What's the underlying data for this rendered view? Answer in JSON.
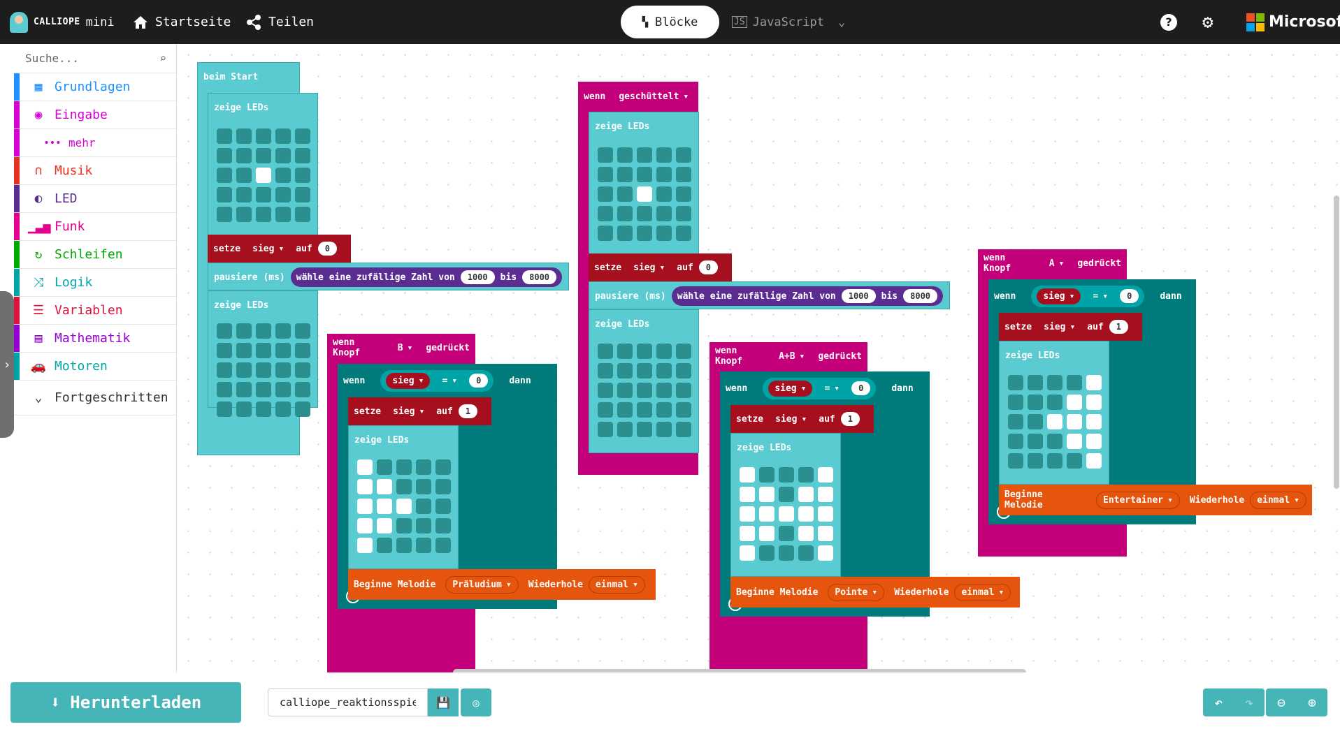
{
  "topbar": {
    "brand": "CALLIOPE",
    "brand_suffix": "mini",
    "home_label": "Startseite",
    "share_label": "Teilen",
    "blocks_label": "Blöcke",
    "javascript_label": "JavaScript",
    "microsoft_label": "Microsoft"
  },
  "sidebar": {
    "search_placeholder": "Suche...",
    "categories": [
      {
        "label": "Grundlagen",
        "color": "#1e90ff"
      },
      {
        "label": "Eingabe",
        "color": "#d400d4"
      },
      {
        "label": "mehr",
        "color": "#d400d4"
      },
      {
        "label": "Musik",
        "color": "#e63022"
      },
      {
        "label": "LED",
        "color": "#5c2d91"
      },
      {
        "label": "Funk",
        "color": "#e3008c"
      },
      {
        "label": "Schleifen",
        "color": "#00aa00"
      },
      {
        "label": "Logik",
        "color": "#00a4a6"
      },
      {
        "label": "Variablen",
        "color": "#dc143c"
      },
      {
        "label": "Mathematik",
        "color": "#9400d3"
      },
      {
        "label": "Motoren",
        "color": "#00a4a6"
      }
    ],
    "advanced_label": "Fortgeschritten"
  },
  "blocks": {
    "start": {
      "hat": "beim Start",
      "show_leds": "zeige LEDs",
      "set": "setze",
      "var": "sieg",
      "to": "auf",
      "val0": "0",
      "pause": "pausiere (ms)",
      "random": "wähle eine zufällige Zahl von",
      "from": "1000",
      "between": "bis",
      "to_val": "8000",
      "show_leds2": "zeige LEDs"
    },
    "shake": {
      "when": "wenn",
      "event": "geschüttelt",
      "show_leds": "zeige LEDs",
      "set": "setze",
      "var": "sieg",
      "to": "auf",
      "val0": "0",
      "pause": "pausiere (ms)",
      "random": "wähle eine zufällige Zahl von",
      "from": "1000",
      "between": "bis",
      "to_val": "8000",
      "show_leds2": "zeige LEDs"
    },
    "btnB": {
      "hat_pre": "wenn Knopf",
      "button": "B",
      "hat_post": "gedrückt",
      "if": "wenn",
      "var": "sieg",
      "op": "=",
      "cmp": "0",
      "then": "dann",
      "set": "setze",
      "to": "auf",
      "val": "1",
      "show_leds": "zeige LEDs",
      "melody": "Beginne Melodie",
      "tune": "Präludium",
      "repeat": "Wiederhole",
      "times": "einmal"
    },
    "btnAB": {
      "hat_pre": "wenn Knopf",
      "button": "A+B",
      "hat_post": "gedrückt",
      "if": "wenn",
      "var": "sieg",
      "op": "=",
      "cmp": "0",
      "then": "dann",
      "set": "setze",
      "to": "auf",
      "val": "1",
      "show_leds": "zeige LEDs",
      "melody": "Beginne Melodie",
      "tune": "Pointe",
      "repeat": "Wiederhole",
      "times": "einmal"
    },
    "btnA": {
      "hat_pre": "wenn Knopf",
      "button": "A",
      "hat_post": "gedrückt",
      "if": "wenn",
      "var": "sieg",
      "op": "=",
      "cmp": "0",
      "then": "dann",
      "set": "setze",
      "to": "auf",
      "val": "1",
      "show_leds": "zeige LEDs",
      "melody": "Beginne Melodie",
      "tune": "Entertainer",
      "repeat": "Wiederhole",
      "times": "einmal"
    }
  },
  "led_patterns": {
    "start_a": [
      0,
      0,
      0,
      0,
      0,
      0,
      0,
      0,
      0,
      0,
      0,
      0,
      1,
      0,
      0,
      0,
      0,
      0,
      0,
      0,
      0,
      0,
      0,
      0,
      0
    ],
    "start_b": [
      0,
      0,
      0,
      0,
      0,
      0,
      0,
      0,
      0,
      0,
      0,
      0,
      0,
      0,
      0,
      0,
      0,
      0,
      0,
      0,
      0,
      0,
      0,
      0,
      0
    ],
    "shake_a": [
      0,
      0,
      0,
      0,
      0,
      0,
      0,
      0,
      0,
      0,
      0,
      0,
      1,
      0,
      0,
      0,
      0,
      0,
      0,
      0,
      0,
      0,
      0,
      0,
      0
    ],
    "shake_b": [
      0,
      0,
      0,
      0,
      0,
      0,
      0,
      0,
      0,
      0,
      0,
      0,
      0,
      0,
      0,
      0,
      0,
      0,
      0,
      0,
      0,
      0,
      0,
      0,
      0
    ],
    "btnB": [
      1,
      0,
      0,
      0,
      0,
      1,
      1,
      0,
      0,
      0,
      1,
      1,
      1,
      0,
      0,
      1,
      1,
      0,
      0,
      0,
      1,
      0,
      0,
      0,
      0
    ],
    "btnAB": [
      1,
      0,
      0,
      0,
      1,
      1,
      1,
      0,
      1,
      1,
      1,
      1,
      1,
      1,
      1,
      1,
      1,
      0,
      1,
      1,
      1,
      0,
      0,
      0,
      1
    ],
    "btnA": [
      0,
      0,
      0,
      0,
      1,
      0,
      0,
      0,
      1,
      1,
      0,
      0,
      1,
      1,
      1,
      0,
      0,
      0,
      1,
      1,
      0,
      0,
      0,
      0,
      1
    ]
  },
  "bottom": {
    "download_label": "Herunterladen",
    "project_name": "calliope_reaktionsspiel"
  }
}
